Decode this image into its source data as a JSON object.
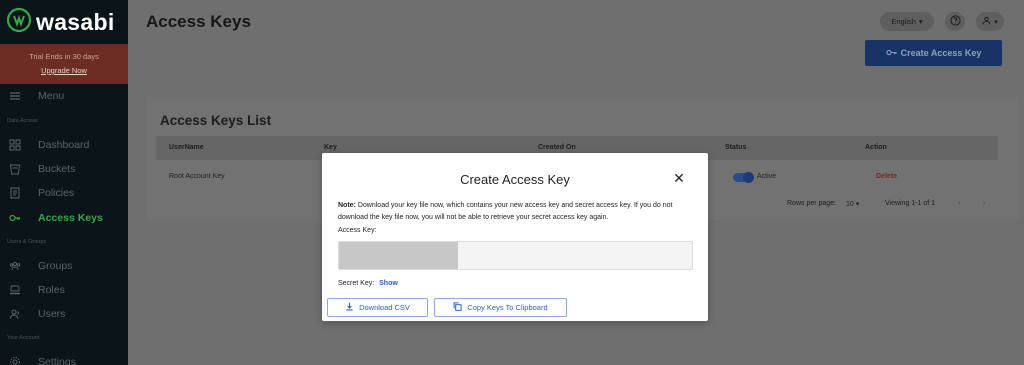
{
  "sidebar": {
    "brand": "wasabi",
    "trial_text": "Trial Ends in 30 days",
    "upgrade_label": "Upgrade Now",
    "menu_label": "Menu",
    "sections": {
      "data_access": "Data Access",
      "users_groups": "Users & Groups",
      "your_account": "Your Account"
    },
    "items": {
      "dashboard": "Dashboard",
      "buckets": "Buckets",
      "policies": "Policies",
      "access_keys": "Access Keys",
      "groups": "Groups",
      "roles": "Roles",
      "users": "Users",
      "settings": "Settings"
    },
    "active_color": "#3aa64b"
  },
  "header": {
    "title": "Access Keys",
    "language": "English",
    "create_button": "Create Access Key"
  },
  "list": {
    "title": "Access Keys List",
    "columns": [
      "UserName",
      "Key",
      "Created On",
      "Status",
      "Action"
    ],
    "row": {
      "username": "Root Account Key",
      "status": "Active",
      "action": "Delete"
    },
    "rows_per_page_label": "Rows per page:",
    "rows_per_page_value": "10",
    "viewing": "Viewing 1-1 of 1"
  },
  "modal": {
    "title": "Create Access Key",
    "note_label": "Note:",
    "note_text": "Download your key file now, which contains your new access key and secret access key. If you do not download the key file now, you will not be able to retrieve your secret access key again.",
    "access_key_label": "Access Key:",
    "secret_key_label": "Secret Key:",
    "show_label": "Show",
    "download_button": "Download CSV",
    "copy_button": "Copy Keys To Clipboard",
    "accent": "#2c5cc5"
  }
}
